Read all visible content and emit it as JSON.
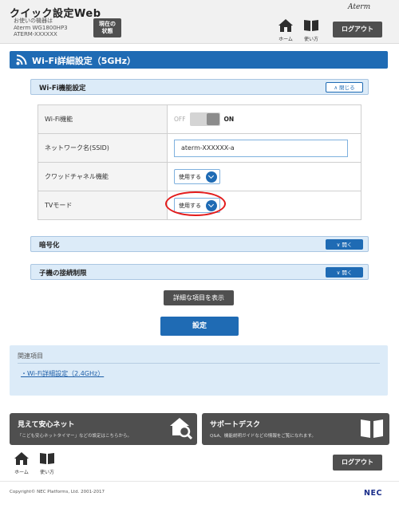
{
  "header": {
    "title": "クイック設定Web",
    "device_line1": "お使いの機器は",
    "device_line2": "Aterm WG1800HP3",
    "device_line3": "ATERM-XXXXXX",
    "status_button_l1": "現在の",
    "status_button_l2": "状態",
    "brand": "Aterm",
    "home_label": "ホーム",
    "manual_label": "使い方",
    "logout_label": "ログアウト"
  },
  "page": {
    "title": "Wi-Fi詳細設定（5GHz）"
  },
  "sections": {
    "wifi_function": {
      "title": "Wi-Fi機能設定",
      "toggle_label": "閉じる",
      "rows": [
        {
          "label": "Wi-Fi機能",
          "off_text": "OFF",
          "on_text": "ON"
        },
        {
          "label": "ネットワーク名(SSID)",
          "value": "aterm-XXXXXX-a"
        },
        {
          "label": "クワッドチャネル機能",
          "select_value": "使用する"
        },
        {
          "label": "TVモード",
          "select_value": "使用する"
        }
      ]
    },
    "encryption": {
      "title": "暗号化",
      "toggle_label": "開く"
    },
    "client_limit": {
      "title": "子機の接続制限",
      "toggle_label": "開く"
    }
  },
  "actions": {
    "show_details": "詳細な項目を表示",
    "save": "設定"
  },
  "related": {
    "title": "関連項目",
    "link": "Wi-Fi詳細設定（2.4GHz）"
  },
  "banners": {
    "left_title": "見えて安心ネット",
    "left_sub": "「こども安心ネットタイマー」などの設定はこちらから。",
    "right_title": "サポートデスク",
    "right_sub": "Q&A、機能説明ガイドなどの情報をご覧になれます。"
  },
  "footer": {
    "home_label": "ホーム",
    "manual_label": "使い方",
    "logout_label": "ログアウト",
    "copyright": "Copyright© NEC Platforms, Ltd. 2001-2017",
    "logo": "NEC"
  },
  "colors": {
    "accent": "#1f6bb4",
    "highlight": "#e31b1b",
    "dark_button": "#4f4f4f"
  }
}
